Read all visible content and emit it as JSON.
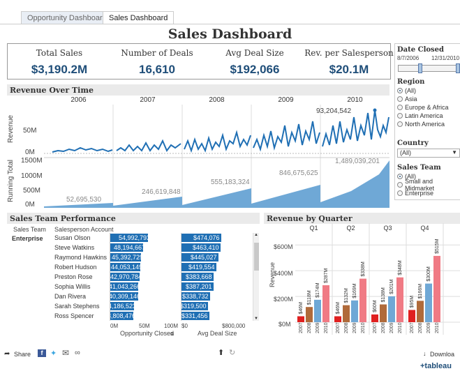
{
  "tabs": [
    "Opportunity Dashboard",
    "Sales Dashboard"
  ],
  "title": "Sales Dashboard",
  "kpis": [
    {
      "label": "Total Sales",
      "value": "$3,190.2M"
    },
    {
      "label": "Number of Deals",
      "value": "16,610"
    },
    {
      "label": "Avg Deal Size",
      "value": "$192,066"
    },
    {
      "label": "Rev. per Salesperson",
      "value": "$20.1M"
    }
  ],
  "filters": {
    "date_title": "Date Closed",
    "date_start": "8/7/2006",
    "date_end": "12/31/2010",
    "region_title": "Region",
    "region_options": [
      "(All)",
      "Asia",
      "Europe & Africa",
      "Latin America",
      "North America"
    ],
    "country_title": "Country",
    "country_value": "(All)",
    "team_title": "Sales Team",
    "team_options": [
      "(All)",
      "Small and Midmarket",
      "Enterprise"
    ]
  },
  "revenue": {
    "title": "Revenue Over Time",
    "years": [
      "2006",
      "2007",
      "2008",
      "2009",
      "2010"
    ],
    "ylabel_top": "Revenue",
    "ylabel_bottom": "Running Total",
    "ticks_top": [
      "50M",
      "0M"
    ],
    "ticks_bottom": [
      "1500M",
      "1000M",
      "500M",
      "0M"
    ],
    "peak_label": "93,204,542",
    "running_labels": [
      "52,695,530",
      "246,619,848",
      "555,183,324",
      "846,675,625",
      "1,489,039,201"
    ]
  },
  "team": {
    "title": "Sales Team Performance",
    "col_team": "Sales Team",
    "col_person": "Salesperson Account",
    "team_name": "Enterprise",
    "rows": [
      {
        "name": "Susan Olson",
        "opp": "54,992,793",
        "deal": "$474,076"
      },
      {
        "name": "Steve Watkins",
        "opp": "48,194,667",
        "deal": "$463,410"
      },
      {
        "name": "Raymond Hawkins",
        "opp": "45,392,729",
        "deal": "$445,027"
      },
      {
        "name": "Robert Hudson",
        "opp": "44,053,149",
        "deal": "$419,554"
      },
      {
        "name": "Preston Rose",
        "opp": "42,970,784",
        "deal": "$383,668"
      },
      {
        "name": "Sophia Willis",
        "opp": "41,043,266",
        "deal": "$387,201"
      },
      {
        "name": "Dan Rivera",
        "opp": "40,309,146",
        "deal": "$338,732"
      },
      {
        "name": "Sarah Stephens",
        "opp": "34,186,523",
        "deal": "$319,500"
      },
      {
        "name": "Ross Spencer",
        "opp": "33,808,476",
        "deal": "$331,456"
      }
    ],
    "opp_axis": [
      "0M",
      "50M",
      "100M"
    ],
    "deal_axis": [
      "$0",
      "$800,000"
    ],
    "opp_label": "Opportunity Closed",
    "deal_label": "Avg Deal Size"
  },
  "quarter": {
    "title": "Revenue by Quarter",
    "quarters": [
      "Q1",
      "Q2",
      "Q3",
      "Q4"
    ],
    "ylabel": "Revenue",
    "ticks": [
      "$600M",
      "$400M",
      "$200M",
      "$0M"
    ],
    "years": [
      "2007",
      "2008",
      "2009",
      "2010"
    ],
    "labels": [
      [
        "$46M",
        "$118M",
        "$174M",
        "$287M"
      ],
      [
        "$46M",
        "$132M",
        "$169M",
        "$338M"
      ],
      [
        "$16M",
        "$60M",
        "$138M",
        "$201M",
        "$348M"
      ],
      [
        "$33M",
        "$95M",
        "$166M",
        "$300M",
        "$515M"
      ]
    ]
  },
  "footer": {
    "share": "Share",
    "download": "Downloa",
    "brand": "+tableau"
  },
  "chart_data": {
    "type": "bar",
    "title": "Revenue by Quarter",
    "ylabel": "Revenue",
    "categories": [
      "Q1",
      "Q2",
      "Q3",
      "Q4"
    ],
    "series": [
      {
        "name": "2007",
        "values": [
          46,
          46,
          60,
          95
        ]
      },
      {
        "name": "2008",
        "values": [
          118,
          132,
          138,
          166
        ]
      },
      {
        "name": "2009",
        "values": [
          174,
          169,
          201,
          300
        ]
      },
      {
        "name": "2010",
        "values": [
          287,
          338,
          348,
          515
        ]
      }
    ],
    "ylim": [
      0,
      650
    ]
  }
}
